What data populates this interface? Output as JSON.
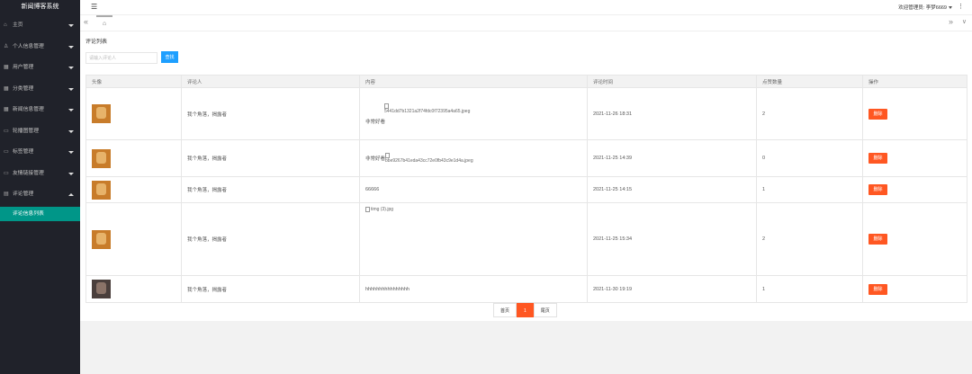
{
  "app": {
    "title": "新闻博客系统"
  },
  "sidebar": {
    "items": [
      {
        "label": "主页",
        "icon": "home-icon"
      },
      {
        "label": "个人信息管理",
        "icon": "user-icon"
      },
      {
        "label": "用户管理",
        "icon": "users-icon"
      },
      {
        "label": "分类管理",
        "icon": "category-icon"
      },
      {
        "label": "新闻信息管理",
        "icon": "news-icon"
      },
      {
        "label": "轮播图管理",
        "icon": "carousel-icon"
      },
      {
        "label": "标签管理",
        "icon": "tag-icon"
      },
      {
        "label": "友情链接管理",
        "icon": "link-icon"
      },
      {
        "label": "评论管理",
        "icon": "comment-icon"
      }
    ],
    "sub_item": "评论信息列表"
  },
  "topbar": {
    "welcome": "欢迎管理员: 李梦6669"
  },
  "page": {
    "title": "评论列表",
    "search_placeholder": "请输入评论人",
    "search_button": "查找"
  },
  "table": {
    "headers": [
      "头像",
      "评论人",
      "内容",
      "评论时间",
      "点赞数量",
      "操作"
    ],
    "rows": [
      {
        "commenter": "我个角落，揭露者",
        "content": "非常好看",
        "image": "5441dd7b1321a2f74fdc0f72395a4a65.jpeg",
        "time": "2021-11-26 18:31",
        "likes": "2",
        "action": "删除"
      },
      {
        "commenter": "我个角落，揭露者",
        "content": "非常好看",
        "image": "bbe9267b41eda43cc72e0fb43c9e1d4a.jpeg",
        "time": "2021-11-25 14:39",
        "likes": "0",
        "action": "删除"
      },
      {
        "commenter": "我个角落，揭露者",
        "content": "66666",
        "image": "",
        "time": "2021-11-25 14:15",
        "likes": "1",
        "action": "删除"
      },
      {
        "commenter": "我个角落，揭露者",
        "content": "",
        "image": "timg (3).jpg",
        "time": "2021-11-25 15:34",
        "likes": "2",
        "action": "删除"
      },
      {
        "commenter": "我个角落，揭露者",
        "content": "hhhhhhhhhhhhhhhh",
        "image": "",
        "time": "2021-11-30 19:19",
        "likes": "1",
        "action": "删除"
      }
    ]
  },
  "pager": {
    "first": "首页",
    "current": "1",
    "last": "尾页"
  },
  "colors": {
    "sidebar": "#20222a",
    "active": "#009688",
    "primary": "#1e9fff",
    "danger": "#ff5722"
  }
}
